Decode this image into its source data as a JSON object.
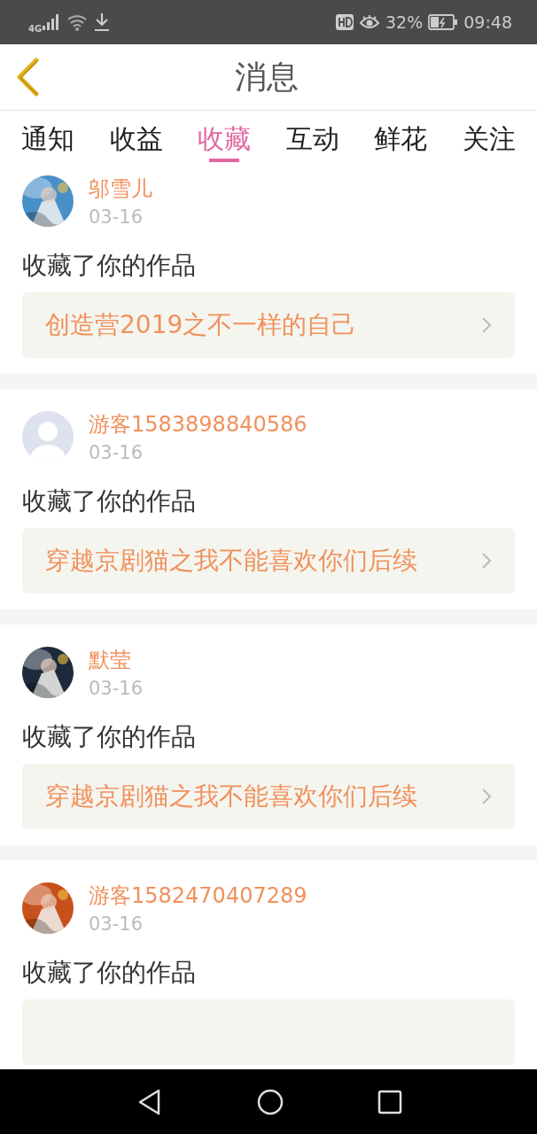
{
  "status_bar": {
    "network": "4G",
    "battery": "32%",
    "time": "09:48"
  },
  "header": {
    "title": "消息"
  },
  "tabs": [
    {
      "label": "通知",
      "selected": false
    },
    {
      "label": "收益",
      "selected": false
    },
    {
      "label": "收藏",
      "selected": true
    },
    {
      "label": "互动",
      "selected": false
    },
    {
      "label": "鲜花",
      "selected": false
    },
    {
      "label": "关注",
      "selected": false
    }
  ],
  "messages": [
    {
      "name": "邬雪儿",
      "date": "03-16",
      "action": "收藏了你的作品",
      "work": "创造营2019之不一样的自己"
    },
    {
      "avatar": {
        "kind": "default"
      },
      "name": "游客1583898840586",
      "date": "03-16",
      "action": "收藏了你的作品",
      "work": "穿越京剧猫之我不能喜欢你们后续"
    },
    {
      "name": "默莹",
      "date": "03-16",
      "action": "收藏了你的作品",
      "work": "穿越京剧猫之我不能喜欢你们后续"
    },
    {
      "name": "游客1582470407289",
      "date": "03-16",
      "action": "收藏了你的作品"
    }
  ]
}
